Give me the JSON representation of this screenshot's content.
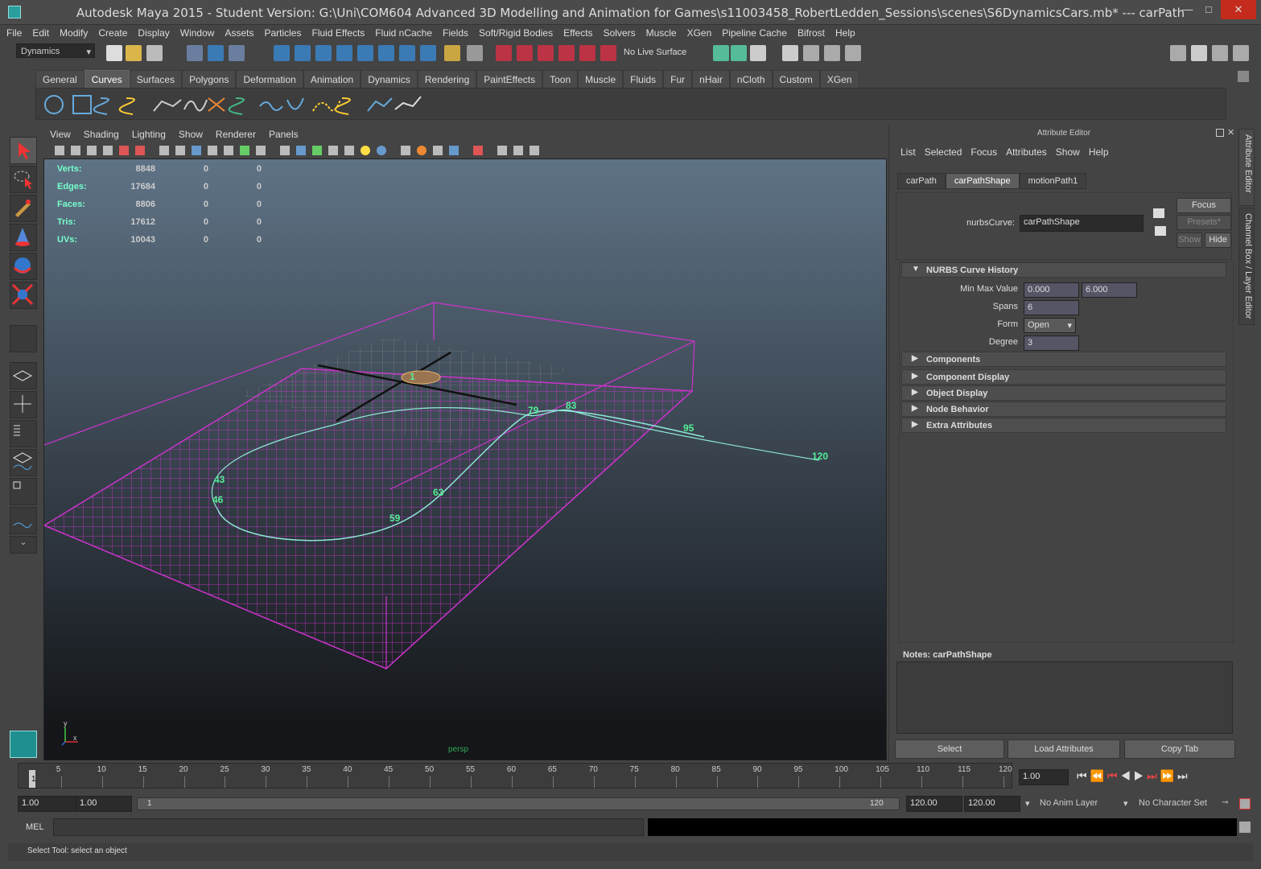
{
  "window": {
    "title": "Autodesk Maya 2015 - Student Version: G:\\Uni\\COM604 Advanced 3D Modelling and Animation for Games\\s11003458_RobertLedden_Sessions\\scenes\\S6DynamicsCars.mb*   ---   carPath",
    "minimize": "—",
    "maximize": "□",
    "close": "✕"
  },
  "menu": [
    "File",
    "Edit",
    "Modify",
    "Create",
    "Display",
    "Window",
    "Assets",
    "Particles",
    "Fluid Effects",
    "Fluid nCache",
    "Fields",
    "Soft/Rigid Bodies",
    "Effects",
    "Solvers",
    "Muscle",
    "XGen",
    "Pipeline Cache",
    "Bifrost",
    "Help"
  ],
  "toolbar": {
    "menuset": "Dynamics",
    "live_surface": "No Live Surface"
  },
  "shelf_tabs": [
    "General",
    "Curves",
    "Surfaces",
    "Polygons",
    "Deformation",
    "Animation",
    "Dynamics",
    "Rendering",
    "PaintEffects",
    "Toon",
    "Muscle",
    "Fluids",
    "Fur",
    "nHair",
    "nCloth",
    "Custom",
    "XGen"
  ],
  "shelf_active": "Curves",
  "viewport": {
    "menu": [
      "View",
      "Shading",
      "Lighting",
      "Show",
      "Renderer",
      "Panels"
    ],
    "camera": "persp",
    "axis_y": "y",
    "axis_x": "x",
    "hud": [
      {
        "label": "Verts:",
        "v": "8848",
        "a": "0",
        "b": "0"
      },
      {
        "label": "Edges:",
        "v": "17684",
        "a": "0",
        "b": "0"
      },
      {
        "label": "Faces:",
        "v": "8806",
        "a": "0",
        "b": "0"
      },
      {
        "label": "Tris:",
        "v": "17612",
        "a": "0",
        "b": "0"
      },
      {
        "label": "UVs:",
        "v": "10043",
        "a": "0",
        "b": "0"
      }
    ],
    "path_labels": [
      "1",
      "43",
      "46",
      "59",
      "63",
      "79",
      "83",
      "95",
      "120"
    ],
    "colors": {
      "grid": "#cc33cc",
      "path": "#8fe8d8",
      "label": "#55ee99"
    }
  },
  "attribute_editor": {
    "header": "Attribute Editor",
    "menu": [
      "List",
      "Selected",
      "Focus",
      "Attributes",
      "Show",
      "Help"
    ],
    "tabs": [
      "carPath",
      "carPathShape",
      "motionPath1"
    ],
    "active_tab": "carPathShape",
    "node_label": "nurbsCurve:",
    "node_value": "carPathShape",
    "focus": "Focus",
    "presets": "Presets*",
    "show": "Show",
    "hide": "Hide",
    "section_history": "NURBS Curve History",
    "min_max_label": "Min Max Value",
    "min_value": "0.000",
    "max_value": "6.000",
    "spans_label": "Spans",
    "spans": "6",
    "form_label": "Form",
    "form": "Open",
    "degree_label": "Degree",
    "degree": "3",
    "sections": [
      "Components",
      "Component Display",
      "Object Display",
      "Node Behavior",
      "Extra Attributes"
    ],
    "notes_label": "Notes:  carPathShape",
    "select": "Select",
    "load_attributes": "Load Attributes",
    "copy_tab": "Copy Tab",
    "side_tab1": "Attribute Editor",
    "side_tab2": "Channel Box / Layer Editor"
  },
  "timeline": {
    "ticks": [
      "5",
      "10",
      "15",
      "20",
      "25",
      "30",
      "35",
      "40",
      "45",
      "50",
      "55",
      "60",
      "65",
      "70",
      "75",
      "80",
      "85",
      "90",
      "95",
      "100",
      "105",
      "110",
      "115",
      "120"
    ],
    "current_marker": "1",
    "current_time": "1.00"
  },
  "range": {
    "start": "1.00",
    "start2": "1.00",
    "range_start": "1",
    "range_end": "120",
    "end": "120.00",
    "end2": "120.00",
    "anim_layer": "No Anim Layer",
    "char_set": "No Character Set"
  },
  "command": {
    "lang": "MEL"
  },
  "help_line": "Select Tool: select an object"
}
